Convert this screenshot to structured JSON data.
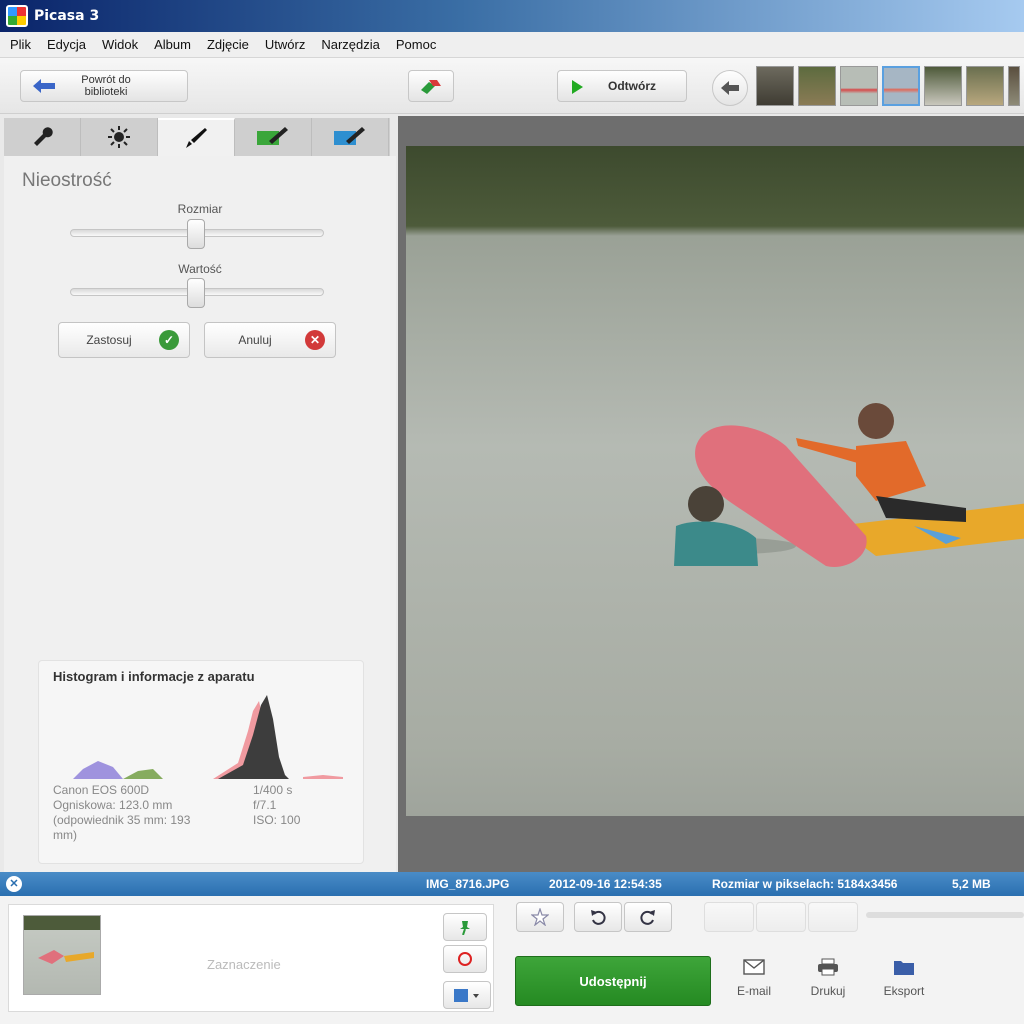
{
  "window": {
    "title": "Picasa 3"
  },
  "menu": [
    "Plik",
    "Edycja",
    "Widok",
    "Album",
    "Zdjęcie",
    "Utwórz",
    "Narzędzia",
    "Pomoc"
  ],
  "toolbar": {
    "back_label_line1": "Powrót do",
    "back_label_line2": "biblioteki",
    "play_label": "Odtwórz"
  },
  "tabs": [
    "wrench-icon",
    "sun-icon",
    "brush-icon",
    "green-brush-icon",
    "blue-brush-icon"
  ],
  "panel": {
    "title": "Nieostrość",
    "slider1": {
      "label": "Rozmiar",
      "value": 0.5
    },
    "slider2": {
      "label": "Wartość",
      "value": 0.5
    },
    "apply_label": "Zastosuj",
    "cancel_label": "Anuluj"
  },
  "histogram": {
    "title": "Histogram i informacje z aparatu",
    "camera": "Canon EOS 600D",
    "focal": "Ogniskowa: 123.0 mm",
    "focal_equiv_1": "(odpowiednik 35 mm: 193",
    "focal_equiv_2": "mm)",
    "shutter": "1/400 s",
    "aperture": "f/7.1",
    "iso": "ISO: 100"
  },
  "status": {
    "filename": "IMG_8716.JPG",
    "datetime": "2012-09-16 12:54:35",
    "dimensions": "Rozmiar w pikselach: 5184x3456",
    "filesize": "5,2 MB"
  },
  "bottom": {
    "selection_label": "Zaznaczenie",
    "share_label": "Udostępnij",
    "email_label": "E-mail",
    "print_label": "Drukuj",
    "export_label": "Eksport"
  },
  "colors": {
    "accent_blue": "#2a6fb0",
    "share_green": "#2e9a2a"
  }
}
